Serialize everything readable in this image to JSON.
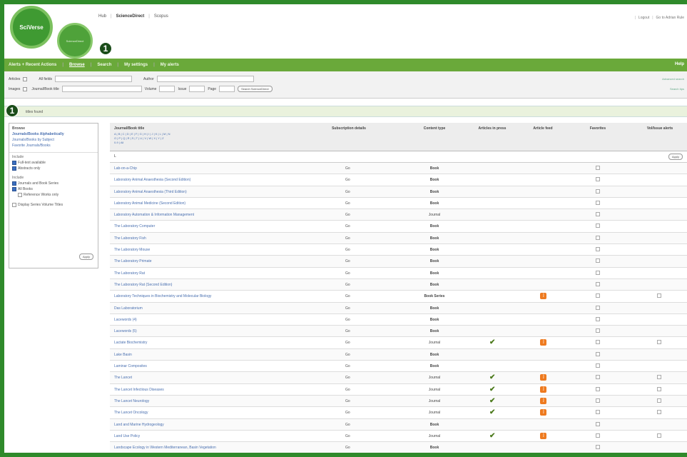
{
  "header": {
    "logo_text": "SciVerse",
    "logo2_text": "ScienceDirect",
    "top_links": [
      "Hub",
      "ScienceDirect",
      "Scopus"
    ],
    "active_link": "ScienceDirect",
    "right_links": [
      "Logout",
      "Go to Adrian Rule"
    ]
  },
  "badges": [
    "1",
    "1"
  ],
  "nav": {
    "items": [
      "Alerts + Recent Actions",
      "Browse",
      "Search",
      "My settings",
      "My alerts"
    ],
    "help": "Help"
  },
  "search": {
    "articles_label": "Articles",
    "allfields_label": "All fields",
    "author_label": "Author",
    "images_label": "Images",
    "journal_label": "Journal/Book title",
    "volume_label": "Volume",
    "issue_label": "Issue",
    "page_label": "Page",
    "button": "Search ScienceDirect",
    "right_top": "Advanced search",
    "right_bottom": "Search tips"
  },
  "results": {
    "text": "titles found"
  },
  "sidebar": {
    "browse_heading": "Browse",
    "links": [
      "Journals/Books Alphabetically",
      "Journals/Books by Subject",
      "Favorite Journals/Books"
    ],
    "include1_label": "Include",
    "include1": [
      {
        "label": "Full-text available",
        "checked": true
      },
      {
        "label": "Abstracts only",
        "checked": true
      }
    ],
    "include2_label": "Include",
    "include2": [
      {
        "label": "Journals and Book Series",
        "checked": true
      },
      {
        "label": "All Books",
        "checked": true
      },
      {
        "label": "Reference Works only",
        "checked": false
      }
    ],
    "display_series": "Display Series Volume Titles",
    "apply": "Apply"
  },
  "table": {
    "headers": {
      "title": "Journal/Book title",
      "subscription": "Subscription details",
      "content": "Content type",
      "aip": "Articles in press",
      "feed": "Article feed",
      "fav": "Favorites",
      "alerts": "Vol/Issue alerts"
    },
    "alpha_line1": "A | B | C | D | E | F | G | H | I | J | K | L | M | N",
    "alpha_line2": "O | P | Q | R | S | T | U | V | W | X | Y | Z",
    "alpha_line3": "0-9 | All",
    "filter_value": "L",
    "apply": "Apply",
    "rows": [
      {
        "title": "Lab-on-a-Chip",
        "sub": "Go",
        "type": "Book",
        "aip": false,
        "feed": false,
        "alert": false
      },
      {
        "title": "Laboratory Animal Anaesthesia (Second Edition)",
        "sub": "Go",
        "type": "Book",
        "aip": false,
        "feed": false,
        "alert": false
      },
      {
        "title": "Laboratory Animal Anaesthesia (Third Edition)",
        "sub": "Go",
        "type": "Book",
        "aip": false,
        "feed": false,
        "alert": false
      },
      {
        "title": "Laboratory Animal Medicine (Second Edition)",
        "sub": "Go",
        "type": "Book",
        "aip": false,
        "feed": false,
        "alert": false
      },
      {
        "title": "Laboratory Automation & Information Management",
        "sub": "Go",
        "type": "Journal",
        "aip": false,
        "feed": false,
        "alert": false
      },
      {
        "title": "The Laboratory Computer",
        "sub": "Go",
        "type": "Book",
        "aip": false,
        "feed": false,
        "alert": false
      },
      {
        "title": "The Laboratory Fish",
        "sub": "Go",
        "type": "Book",
        "aip": false,
        "feed": false,
        "alert": false
      },
      {
        "title": "The Laboratory Mouse",
        "sub": "Go",
        "type": "Book",
        "aip": false,
        "feed": false,
        "alert": false
      },
      {
        "title": "The Laboratory Primate",
        "sub": "Go",
        "type": "Book",
        "aip": false,
        "feed": false,
        "alert": false
      },
      {
        "title": "The Laboratory Rat",
        "sub": "Go",
        "type": "Book",
        "aip": false,
        "feed": false,
        "alert": false
      },
      {
        "title": "The Laboratory Rat (Second Edition)",
        "sub": "Go",
        "type": "Book",
        "aip": false,
        "feed": false,
        "alert": false
      },
      {
        "title": "Laboratory Techniques in Biochemistry and Molecular Biology",
        "sub": "Go",
        "type": "Book Series",
        "aip": false,
        "feed": true,
        "alert": true
      },
      {
        "title": "Das Laboratorium",
        "sub": "Go",
        "type": "Book",
        "aip": false,
        "feed": false,
        "alert": false
      },
      {
        "title": "Lacewords (4)",
        "sub": "Go",
        "type": "Book",
        "aip": false,
        "feed": false,
        "alert": false
      },
      {
        "title": "Lacewords (5)",
        "sub": "Go",
        "type": "Book",
        "aip": false,
        "feed": false,
        "alert": false
      },
      {
        "title": "Lactate Biochemistry",
        "sub": "Go",
        "type": "Journal",
        "aip": true,
        "feed": true,
        "alert": true
      },
      {
        "title": "Lake Basin",
        "sub": "Go",
        "type": "Book",
        "aip": false,
        "feed": false,
        "alert": false
      },
      {
        "title": "Laminar Composites",
        "sub": "Go",
        "type": "Book",
        "aip": false,
        "feed": false,
        "alert": false
      },
      {
        "title": "The Lancet",
        "sub": "Go",
        "type": "Journal",
        "aip": true,
        "feed": true,
        "alert": true
      },
      {
        "title": "The Lancet Infectious Diseases",
        "sub": "Go",
        "type": "Journal",
        "aip": true,
        "feed": true,
        "alert": true
      },
      {
        "title": "The Lancet Neurology",
        "sub": "Go",
        "type": "Journal",
        "aip": true,
        "feed": true,
        "alert": true
      },
      {
        "title": "The Lancet Oncology",
        "sub": "Go",
        "type": "Journal",
        "aip": true,
        "feed": true,
        "alert": true
      },
      {
        "title": "Land and Marine Hydrogeology",
        "sub": "Go",
        "type": "Book",
        "aip": false,
        "feed": false,
        "alert": false
      },
      {
        "title": "Land Use Policy",
        "sub": "Go",
        "type": "Journal",
        "aip": true,
        "feed": true,
        "alert": true
      },
      {
        "title": "Landscape Ecology in Western Mediterranean, Basin Vegetation",
        "sub": "Go",
        "type": "Book",
        "aip": false,
        "feed": false,
        "alert": false
      }
    ]
  },
  "colors": {
    "frame": "#2f8a2b",
    "nav": "#6aa93a",
    "link": "#4a70b0",
    "feed": "#ee7a1f"
  }
}
